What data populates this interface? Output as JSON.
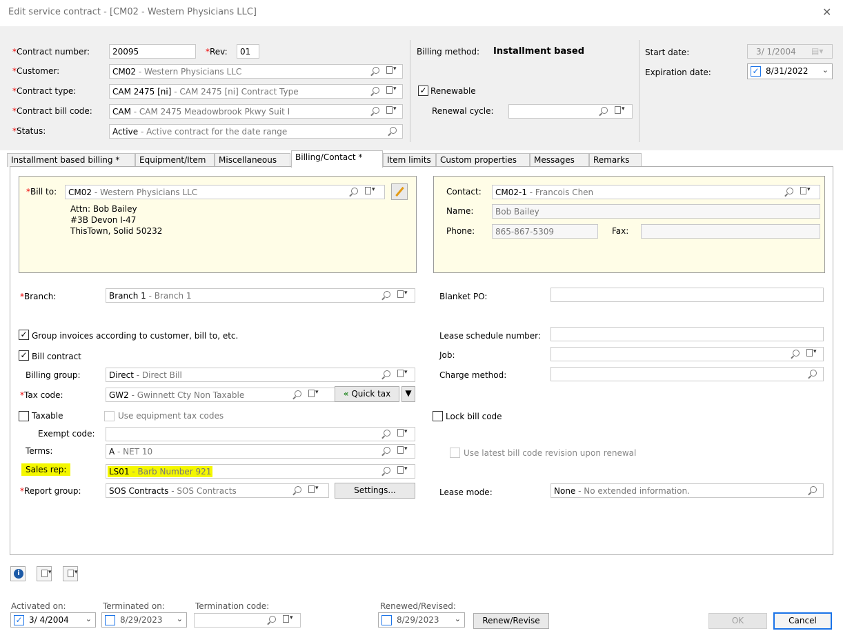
{
  "window": {
    "title": "Edit service contract - [CM02 - Western Physicians LLC]"
  },
  "header": {
    "contract_number_label": "*Contract number:",
    "contract_number": "20095",
    "rev_label": "*Rev:",
    "rev": "01",
    "customer_label": "*Customer:",
    "customer_code": "CM02",
    "customer_desc": " - Western Physicians LLC",
    "contract_type_label": "*Contract type:",
    "contract_type_code": "CAM 2475 [ni]",
    "contract_type_desc": " - CAM 2475 [ni] Contract Type",
    "bill_code_label": "*Contract bill code:",
    "bill_code": "CAM",
    "bill_code_desc": " - CAM 2475 Meadowbrook Pkwy Suit I",
    "status_label": "*Status:",
    "status_code": "Active",
    "status_desc": " - Active contract for the date range",
    "billing_method_label": "Billing method:",
    "billing_method": "Installment based",
    "renewable_label": "Renewable",
    "renewal_cycle_label": "Renewal cycle:",
    "start_date_label": "Start date:",
    "start_date": "3/ 1/2004",
    "expiration_label": "Expiration date:",
    "expiration_date": "8/31/2022"
  },
  "tabs": [
    {
      "label": "Installment based billing *"
    },
    {
      "label": "Equipment/Item"
    },
    {
      "label": "Miscellaneous"
    },
    {
      "label": "Billing/Contact *"
    },
    {
      "label": "Item limits"
    },
    {
      "label": "Custom properties"
    },
    {
      "label": "Messages"
    },
    {
      "label": "Remarks"
    }
  ],
  "billto": {
    "label": "*Bill to:",
    "code": "CM02",
    "desc": " - Western Physicians LLC",
    "attn": "Attn: Bob Bailey",
    "addr1": "#3B Devon I-47",
    "addr2": "ThisTown, Solid 50232"
  },
  "contact": {
    "contact_label": "Contact:",
    "contact_code": "CM02-1",
    "contact_desc": " - Francois Chen",
    "name_label": "Name:",
    "name": "Bob Bailey",
    "phone_label": "Phone:",
    "phone": "865-867-5309",
    "fax_label": "Fax:"
  },
  "form": {
    "branch_label": "*Branch:",
    "branch_code": "Branch 1",
    "branch_desc": " - Branch 1",
    "group_invoices_label": "Group invoices according to customer, bill to, etc.",
    "bill_contract_label": "Bill contract",
    "billing_group_label": "Billing group:",
    "billing_group_code": "Direct",
    "billing_group_desc": " - Direct Bill",
    "tax_code_label": "*Tax code:",
    "tax_code": "GW2",
    "tax_code_desc": " - Gwinnett Cty Non Taxable",
    "quick_tax_label": "Quick tax",
    "taxable_label": "Taxable",
    "use_equipment_tax_label": "Use equipment tax codes",
    "exempt_code_label": "Exempt code:",
    "terms_label": "Terms:",
    "terms_code": "A",
    "terms_desc": " - NET 10",
    "sales_rep_label": "Sales rep:",
    "sales_rep_code": "LS01",
    "sales_rep_desc": " - Barb Number 921",
    "report_group_label": "*Report group:",
    "report_group_code": "SOS Contracts",
    "report_group_desc": " - SOS Contracts",
    "settings_label": "Settings...",
    "blanket_po_label": "Blanket PO:",
    "lease_schedule_label": "Lease schedule number:",
    "job_label": "Job:",
    "charge_method_label": "Charge method:",
    "lock_bill_code_label": "Lock bill code",
    "use_latest_label": "Use latest bill code revision upon renewal",
    "lease_mode_label": "Lease mode:",
    "lease_mode_code": "None",
    "lease_mode_desc": " - No extended information."
  },
  "footer": {
    "activated_label": "Activated on:",
    "activated_date": "3/ 4/2004",
    "terminated_label": "Terminated on:",
    "terminated_date": "8/29/2023",
    "termination_code_label": "Termination code:",
    "renewed_label": "Renewed/Revised:",
    "renewed_date": "8/29/2023",
    "renew_button": "Renew/Revise",
    "ok_button": "OK",
    "cancel_button": "Cancel"
  }
}
